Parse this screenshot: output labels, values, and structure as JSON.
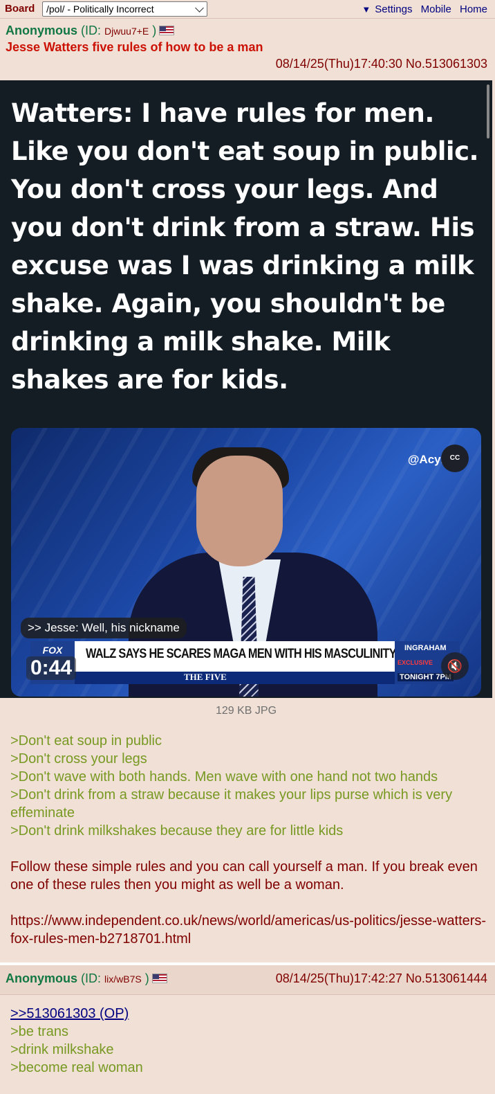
{
  "topbar": {
    "board_label": "Board",
    "board_select_value": "/pol/ - Politically Incorrect",
    "settings_arrow": "▼",
    "settings": "Settings",
    "mobile": "Mobile",
    "home": "Home"
  },
  "op": {
    "name": "Anonymous",
    "id_prefix": "(ID:",
    "id": "Djwuu7+E",
    "id_suffix": ")",
    "flag": "us-flag-icon",
    "subject": "Jesse Watters five rules of how to be a man",
    "datetime": "08/14/25(Thu)17:40:30 No.513061303",
    "image": {
      "headline_text": "Watters: I have rules for men. Like you don't eat soup in public. You don't cross your legs. And you don't drink from a straw. His excuse was I was drinking a milk shake. Again, you shouldn't be drinking a milk shake. Milk shakes are for kids.",
      "handle": "@Acyn",
      "cc": "CC",
      "caption": ">> Jesse: Well, his nickname",
      "chyron": "WALZ SAYS HE SCARES MAGA MEN WITH HIS MASCULINITY",
      "show": "THE FIVE",
      "logo": "FOX",
      "timecode": "0:44",
      "promo_show": "INGRAHAM",
      "promo_sub": "EXCLUSIVE",
      "promo_time": "TONIGHT 7PM"
    },
    "file_info": "129 KB JPG",
    "quotes": [
      ">Don't eat soup in public",
      ">Don't cross your legs",
      ">Don't wave with both hands. Men wave with one hand not two hands",
      ">Don't drink from a straw because it makes your lips purse which is very effeminate",
      ">Don't drink milkshakes because they are for little kids"
    ],
    "paragraph": "Follow these simple rules and you can call yourself a man. If you break even one of these rules then you might as well be a woman.",
    "link": "https://www.independent.co.uk/news/world/americas/us-politics/jesse-watters-fox-rules-men-b2718701.html"
  },
  "reply": {
    "name": "Anonymous",
    "id_prefix": "(ID:",
    "id": "lix/wB7S",
    "id_suffix": ")",
    "datetime": "08/14/25(Thu)17:42:27 No.513061444",
    "backlink": ">>513061303 (OP)",
    "quotes": [
      ">be trans",
      ">drink milkshake",
      ">become real woman"
    ]
  },
  "colors": {
    "background": "#f0e0d6",
    "name": "#117743",
    "subject": "#cc1105",
    "text": "#800000",
    "greentext": "#789922",
    "link": "#000080"
  }
}
